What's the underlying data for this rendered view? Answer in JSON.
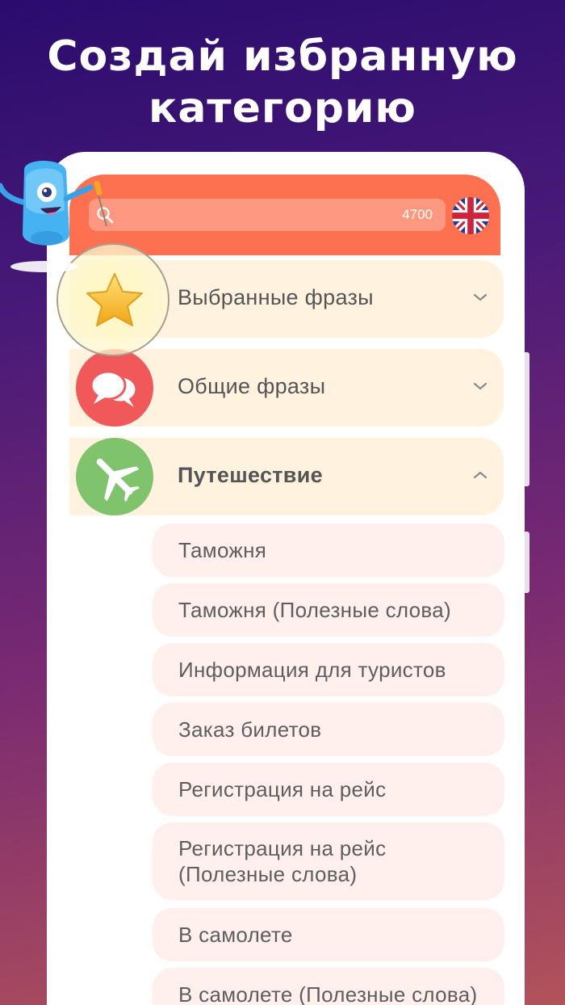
{
  "headline": {
    "line1": "Создай избранную",
    "line2": "категорию"
  },
  "topbar": {
    "search_count": "4700",
    "language_flag": "uk-flag-icon",
    "accent_color": "#fe7150"
  },
  "categories": [
    {
      "label": "Выбранные фразы",
      "icon": "star-icon",
      "color": "#f5c02a",
      "expanded": false
    },
    {
      "label": "Общие фразы",
      "icon": "speech-bubbles-icon",
      "color": "#f0585a",
      "expanded": false
    },
    {
      "label": "Путешествие",
      "icon": "airplane-icon",
      "color": "#7fc46c",
      "expanded": true
    }
  ],
  "subcategories": [
    {
      "label": "Таможня"
    },
    {
      "label": "Таможня (Полезные слова)"
    },
    {
      "label": "Информация для туристов"
    },
    {
      "label": "Заказ билетов"
    },
    {
      "label": "Регистрация на рейс"
    },
    {
      "label_line1": "Регистрация на рейс",
      "label_line2": "(Полезные слова)"
    },
    {
      "label": "В самолете"
    },
    {
      "label": "В самолете (Полезные слова)"
    }
  ]
}
